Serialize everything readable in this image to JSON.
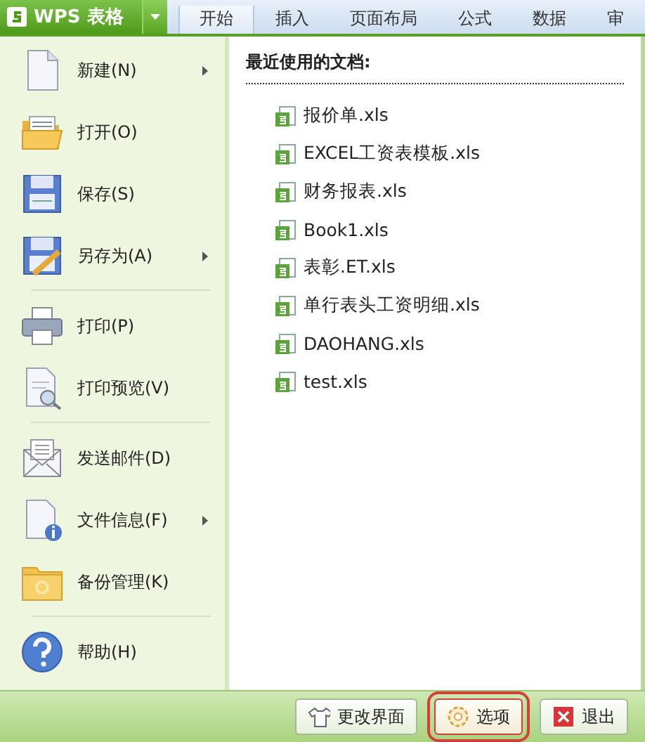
{
  "app_button": {
    "label": "WPS 表格"
  },
  "tabs": [
    {
      "label": "开始",
      "selected": true
    },
    {
      "label": "插入",
      "selected": false
    },
    {
      "label": "页面布局",
      "selected": false
    },
    {
      "label": "公式",
      "selected": false
    },
    {
      "label": "数据",
      "selected": false
    },
    {
      "label": "审",
      "selected": false
    }
  ],
  "menu": [
    {
      "kind": "new",
      "label": "新建(N)",
      "submenu": true,
      "separator_after": false
    },
    {
      "kind": "open",
      "label": "打开(O)",
      "submenu": false,
      "separator_after": false
    },
    {
      "kind": "save",
      "label": "保存(S)",
      "submenu": false,
      "separator_after": false
    },
    {
      "kind": "saveas",
      "label": "另存为(A)",
      "submenu": true,
      "separator_after": true
    },
    {
      "kind": "print",
      "label": "打印(P)",
      "submenu": false,
      "separator_after": false
    },
    {
      "kind": "preview",
      "label": "打印预览(V)",
      "submenu": false,
      "separator_after": true
    },
    {
      "kind": "mail",
      "label": "发送邮件(D)",
      "submenu": false,
      "separator_after": false
    },
    {
      "kind": "info",
      "label": "文件信息(F)",
      "submenu": true,
      "separator_after": false
    },
    {
      "kind": "backup",
      "label": "备份管理(K)",
      "submenu": false,
      "separator_after": true
    },
    {
      "kind": "help",
      "label": "帮助(H)",
      "submenu": false,
      "separator_after": false
    }
  ],
  "recent": {
    "title": "最近使用的文档:",
    "files": [
      "报价单.xls",
      "EXCEL工资表模板.xls",
      "财务报表.xls",
      "Book1.xls",
      "表彰.ET.xls",
      "单行表头工资明细.xls",
      "DAOHANG.xls",
      "test.xls"
    ]
  },
  "footer_buttons": [
    {
      "kind": "skin",
      "label": "更改界面",
      "highlighted": false
    },
    {
      "kind": "options",
      "label": "选项",
      "highlighted": true
    },
    {
      "kind": "exit",
      "label": "退出",
      "highlighted": false
    }
  ]
}
